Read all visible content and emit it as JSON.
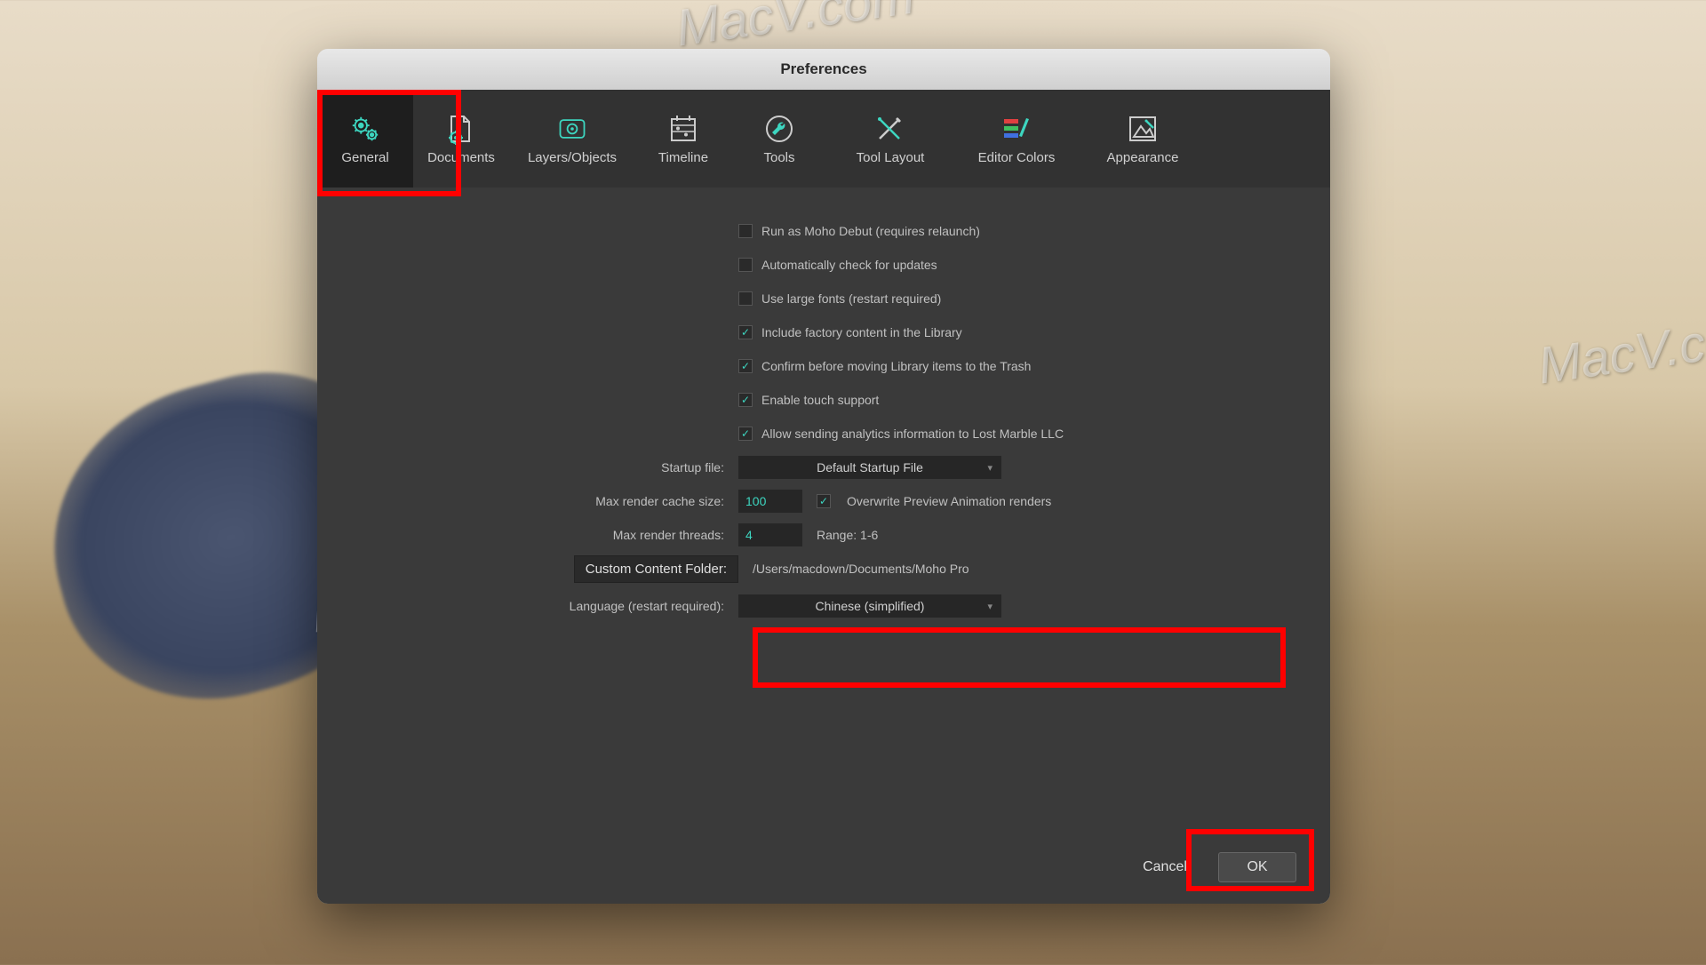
{
  "window": {
    "title": "Preferences"
  },
  "tabs": [
    {
      "label": "General"
    },
    {
      "label": "Documents"
    },
    {
      "label": "Layers/Objects"
    },
    {
      "label": "Timeline"
    },
    {
      "label": "Tools"
    },
    {
      "label": "Tool Layout"
    },
    {
      "label": "Editor Colors"
    },
    {
      "label": "Appearance"
    }
  ],
  "checkboxes": {
    "run_debut": "Run as Moho Debut (requires relaunch)",
    "auto_update": "Automatically check for updates",
    "large_fonts": "Use large fonts (restart required)",
    "factory_content": "Include factory content in the Library",
    "confirm_trash": "Confirm before moving Library items to the Trash",
    "touch": "Enable touch support",
    "analytics": "Allow sending analytics information to Lost Marble LLC",
    "overwrite_preview": "Overwrite Preview Animation renders"
  },
  "labels": {
    "startup_file": "Startup file:",
    "max_cache": "Max render cache size:",
    "max_threads": "Max render threads:",
    "threads_range": "Range: 1-6",
    "ccf": "Custom Content Folder:",
    "language": "Language (restart required):"
  },
  "values": {
    "startup_file": "Default Startup File",
    "max_cache": "100",
    "max_threads": "4",
    "ccf_path": "/Users/macdown/Documents/Moho Pro",
    "language": "Chinese (simplified)"
  },
  "buttons": {
    "cancel": "Cancel",
    "ok": "OK"
  },
  "watermark": "MacV.com",
  "colors": {
    "accent": "#3dd6c0"
  }
}
